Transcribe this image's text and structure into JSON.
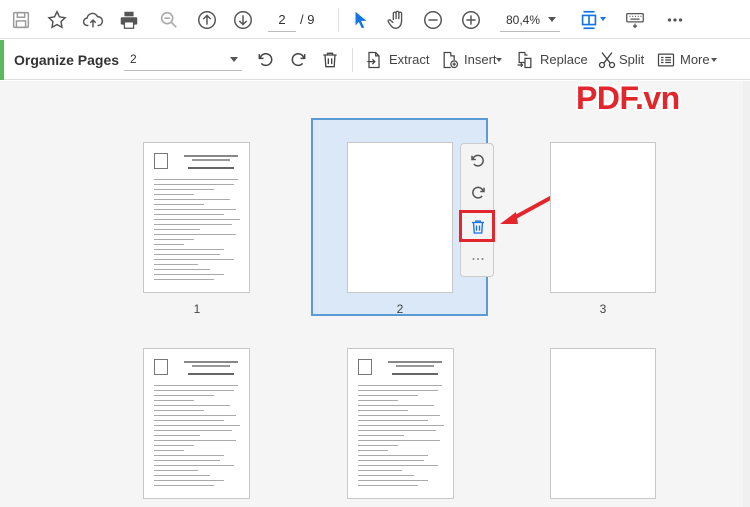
{
  "toolbar": {
    "page_current": "2",
    "page_total": "/ 9",
    "zoom": "80,4%",
    "icons": [
      "save-icon",
      "bookmark-star-icon",
      "upload-cloud-icon",
      "print-icon",
      "zoom-search-icon",
      "prev-page-icon",
      "next-page-icon",
      "select-cursor-icon",
      "hand-tool-icon",
      "zoom-out-icon",
      "zoom-in-icon",
      "page-fit-icon",
      "keyboard-icon",
      "more-icon"
    ]
  },
  "organize": {
    "title": "Organize Pages",
    "range_value": "2",
    "extract_label": "Extract",
    "insert_label": "Insert",
    "replace_label": "Replace",
    "split_label": "Split",
    "more_label": "More"
  },
  "pages": [
    {
      "number": "1",
      "type": "document"
    },
    {
      "number": "2",
      "type": "blank",
      "selected": true
    },
    {
      "number": "3",
      "type": "blank"
    },
    {
      "number": "",
      "type": "document"
    },
    {
      "number": "",
      "type": "document"
    },
    {
      "number": "",
      "type": "blank"
    }
  ],
  "watermark": "PDF.vn",
  "colors": {
    "accent": "#5cb85c",
    "selection": "#dbe8f7",
    "selection_border": "#5b9bd5",
    "highlight": "#e3262b",
    "toolbar_blue": "#1473e6"
  }
}
